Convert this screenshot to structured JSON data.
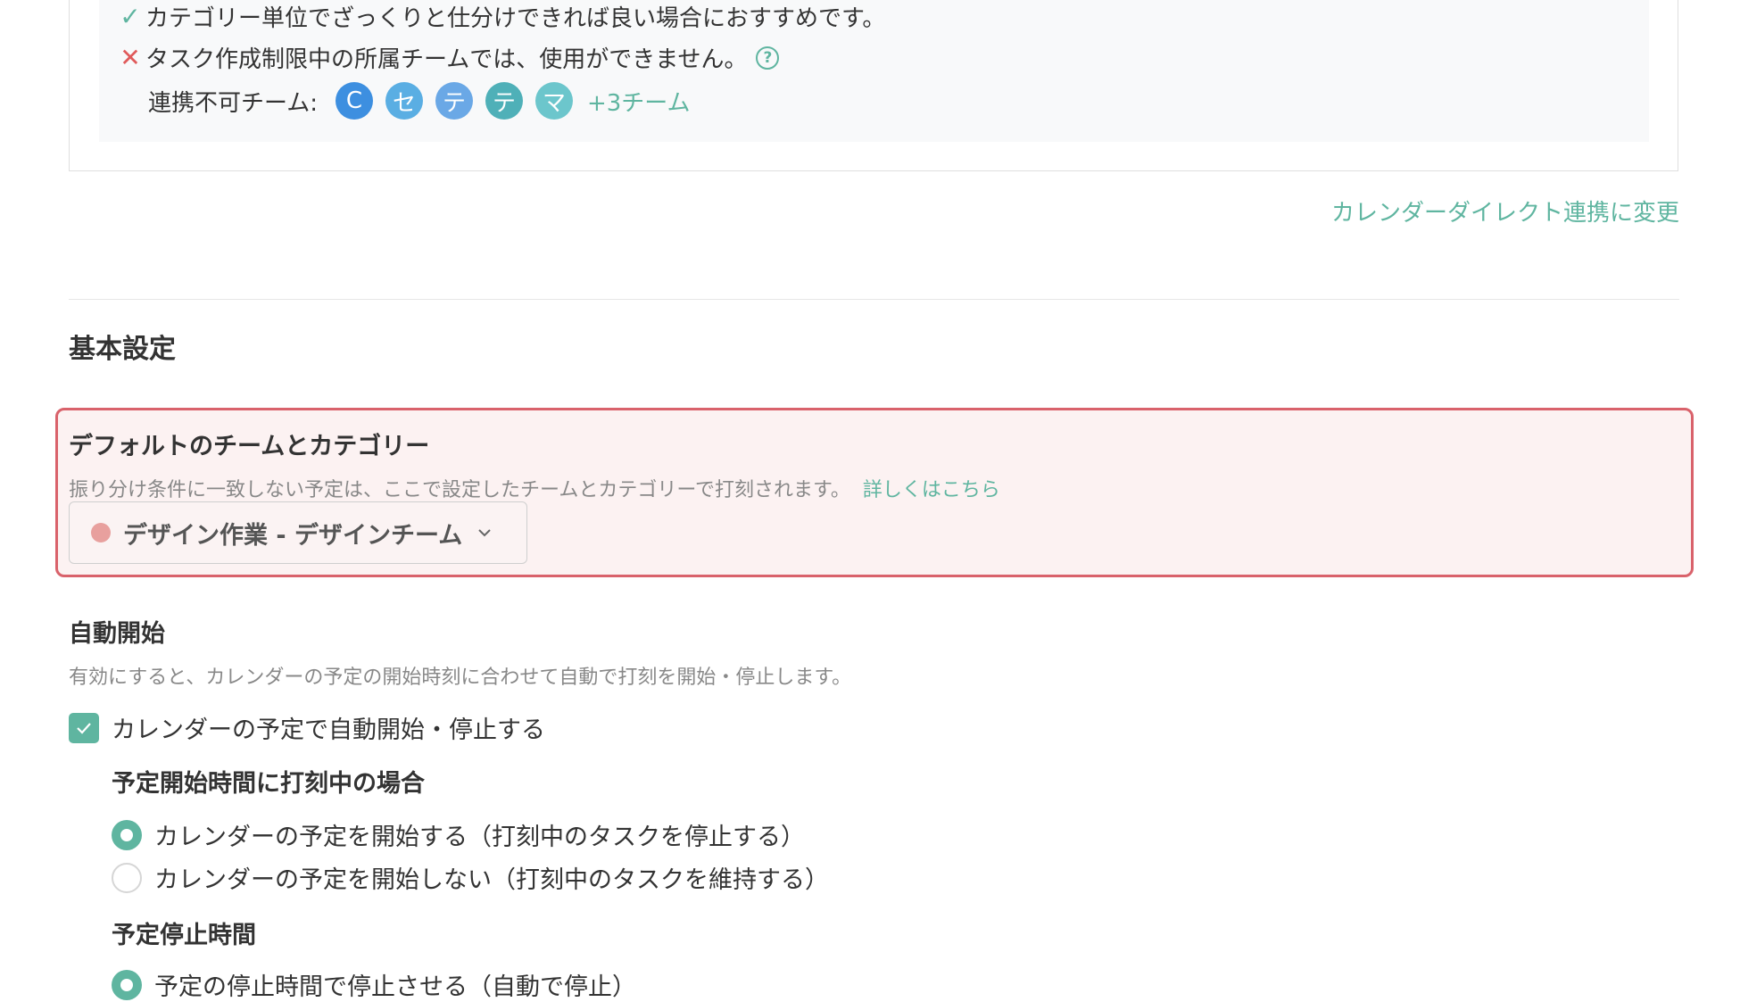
{
  "info": {
    "ok_text": "カテゴリー単位でざっくりと仕分けできれば良い場合におすすめです。",
    "ng_text": "タスク作成制限中の所属チームでは、使用ができません。",
    "teams_label": "連携不可チーム:",
    "teams": [
      {
        "letter": "C",
        "color": "#3d8fe0"
      },
      {
        "letter": "セ",
        "color": "#5aaee3"
      },
      {
        "letter": "テ",
        "color": "#6aa8e6"
      },
      {
        "letter": "テ",
        "color": "#4fb0b8"
      },
      {
        "letter": "マ",
        "color": "#6cc6cc"
      }
    ],
    "more_teams": "+3チーム"
  },
  "switch_link": "カレンダーダイレクト連携に変更",
  "section_title": "基本設定",
  "default_team": {
    "title": "デフォルトのチームとカテゴリー",
    "description": "振り分け条件に一致しない予定は、ここで設定したチームとカテゴリーで打刻されます。",
    "link": "詳しくはこちら",
    "selected": "デザイン作業 - デザインチーム",
    "dot_color": "#e8a09e"
  },
  "auto_start": {
    "title": "自動開始",
    "description": "有効にすると、カレンダーの予定の開始時刻に合わせて自動で打刻を開始・停止します。",
    "checkbox_label": "カレンダーの予定で自動開始・停止する",
    "checked": true,
    "start_group": {
      "title": "予定開始時間に打刻中の場合",
      "options": [
        {
          "label": "カレンダーの予定を開始する（打刻中のタスクを停止する）",
          "selected": true
        },
        {
          "label": "カレンダーの予定を開始しない（打刻中のタスクを維持する）",
          "selected": false
        }
      ]
    },
    "stop_group": {
      "title": "予定停止時間",
      "options": [
        {
          "label": "予定の停止時間で停止させる（自動で停止）",
          "selected": true
        }
      ]
    }
  },
  "colors": {
    "accent": "#5fb5a0",
    "error": "#e05a5a",
    "highlight_border": "#d9626b"
  }
}
